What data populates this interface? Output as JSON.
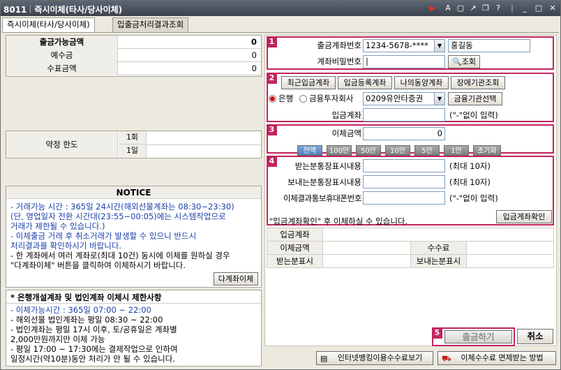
{
  "window": {
    "code": "8011",
    "title": "즉시이체(타사/당사이체)"
  },
  "tabs": [
    {
      "label": "즉시이체(타사/당사이체)",
      "active": true
    },
    {
      "label": "입출금처리결과조회",
      "active": false
    }
  ],
  "balance": {
    "rows": [
      {
        "label": "출금가능금액",
        "value": "0",
        "bold": true
      },
      {
        "label": "예수금",
        "value": "0"
      },
      {
        "label": "수표금액",
        "value": "0"
      }
    ]
  },
  "limit": {
    "label": "약정 한도",
    "row1": "1회",
    "row2": "1일"
  },
  "notice": {
    "title": "NOTICE",
    "lines": [
      "- 거래가능 시간 : 365일 24시간(해외선물계좌는 08:30~23:30)",
      "  (단, 영업일자 전환 시간대(23:55~00:05)에는 시스템작업으로",
      "  거래가 제한될 수 있습니다.)",
      "- 이체출금 거래 후 취소거래가 발생할 수 있으니 반드시",
      "  처리결과를 확인하시기 바랍니다.",
      "- 한 계좌에서 여러 계좌로(최대 10건) 동시에 이체를 원하실 경우",
      "  \"다계좌이체\" 버튼을 클릭하여 이체하시기 바랍니다."
    ],
    "multi_button": "다계좌이체"
  },
  "restrict": {
    "title": "* 은행개설계좌 및 법인계좌 이체시 제한사항",
    "lines": [
      "- 이체가능시간 : 365일 07:00 ~ 22:00",
      "- 해외선물 법인계좌는 평일 08:30 ~ 22:00",
      "- 법인계좌는 평일 17시 이후, 토/공휴일은 계좌별",
      "  2,000만원까지만 이체 가능",
      "- 평일 17:00 ~ 17:30에는 결제작업으로 인하여",
      "  일정시간(약10분)동안 처리가 안 될 수 있습니다."
    ]
  },
  "section1": {
    "badge": "1",
    "account_label": "출금계좌번호",
    "account_value": "1234-5678-****",
    "owner_name": "홍길동",
    "password_label": "계좌비밀번호",
    "password_value": "|",
    "lookup_button": "조회"
  },
  "section2": {
    "badge": "2",
    "buttons": [
      "최근입금계좌",
      "입금등록계좌",
      "나의동양계좌",
      "장애기관조회"
    ],
    "radio_bank": "은행",
    "radio_invest": "금융투자회사",
    "institution_value": "0209유안타증권",
    "institution_button": "금융기관선택",
    "deposit_label": "입금계좌",
    "deposit_value": "",
    "deposit_hint": "(\"-\"없이 입력)"
  },
  "section3": {
    "badge": "3",
    "amount_label": "이체금액",
    "amount_value": "0",
    "amount_buttons": [
      "전액",
      "100만",
      "50만",
      "10만",
      "5만",
      "1만",
      "초기화"
    ]
  },
  "section4": {
    "badge": "4",
    "fields": [
      {
        "label": "받는분통장표시내용",
        "hint": "(최대 10자)"
      },
      {
        "label": "보내는분통장표시내용",
        "hint": "(최대 10자)"
      },
      {
        "label": "이체결과통보휴대폰번호",
        "hint": "(\"-\"없이 입력)"
      }
    ],
    "note": "\"입금계좌확인\" 후 이체하실 수 있습니다.",
    "confirm_button": "입금계좌확인"
  },
  "summary": {
    "deposit": "입금계좌",
    "amount": "이체금액",
    "fee": "수수료",
    "receiver": "받는분표시",
    "sender": "보내는분표시"
  },
  "section5": {
    "badge": "5",
    "withdraw_button": "출금하기",
    "cancel_button": "취소"
  },
  "footer": {
    "fee_view_button": "인터넷뱅킹이용수수료보기",
    "fee_exempt_button": "이체수수료 면제받는 방법"
  }
}
